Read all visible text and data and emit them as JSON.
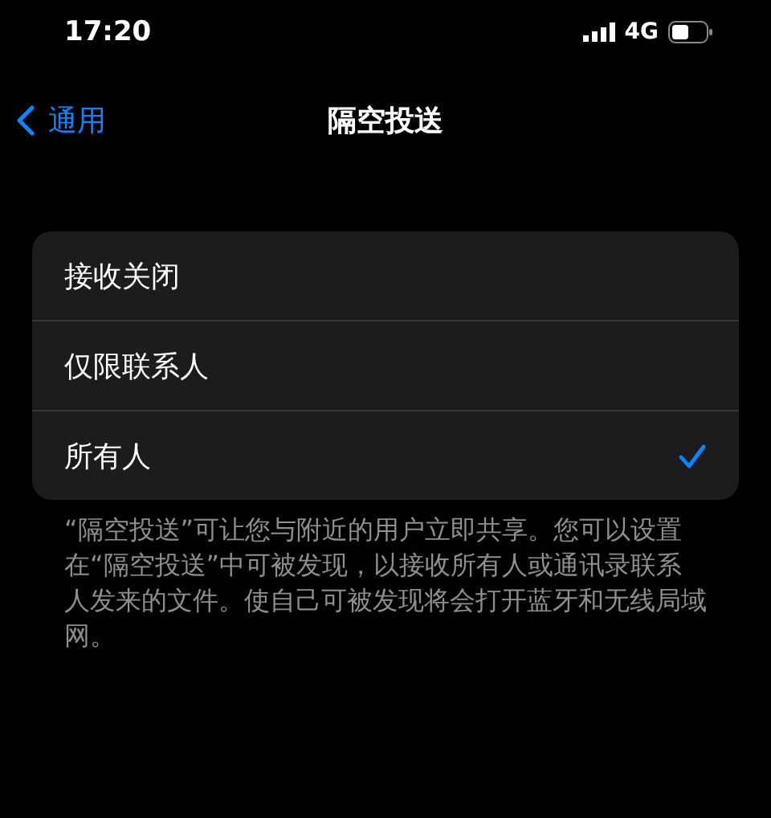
{
  "status_bar": {
    "time": "17:20",
    "network": "4G"
  },
  "nav": {
    "back": "通用",
    "title": "隔空投送"
  },
  "options": [
    {
      "label": "接收关闭",
      "selected": false
    },
    {
      "label": "仅限联系人",
      "selected": false
    },
    {
      "label": "所有人",
      "selected": true
    }
  ],
  "footer": "“隔空投送”可让您与附近的用户立即共享。您可以设置在“隔空投送”中可被发现，以接收所有人或通讯录联系人发来的文件。使自己可被发现将会打开蓝牙和无线局域网。"
}
